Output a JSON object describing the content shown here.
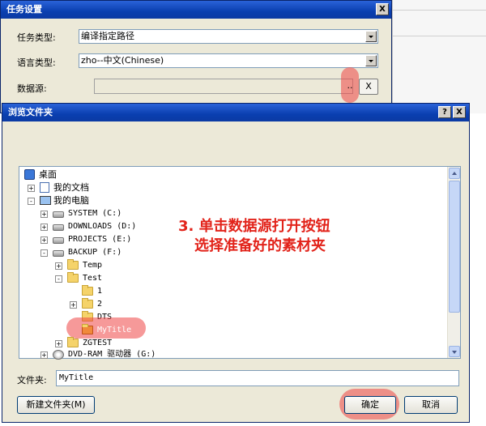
{
  "task_window": {
    "title": "任务设置",
    "close_glyph": "X",
    "task_type_label": "任务类型:",
    "task_type_value": "编译指定路径",
    "language_label": "语言类型:",
    "language_value": "zho--中文(Chinese)",
    "data_source_label": "数据源:",
    "browse_glyph": "..",
    "clear_label": "X"
  },
  "browse_dialog": {
    "title": "浏览文件夹",
    "help_glyph": "?",
    "close_glyph": "X",
    "tree": [
      {
        "label": "桌面",
        "expander": "",
        "icon": "desktop-icon"
      },
      {
        "label": "我的文档",
        "expander": "+",
        "icon": "my-documents-icon"
      },
      {
        "label": "我的电脑",
        "expander": "-",
        "icon": "my-computer-icon"
      },
      {
        "label": "SYSTEM (C:)",
        "expander": "+",
        "icon": "drive-icon"
      },
      {
        "label": "DOWNLOADS (D:)",
        "expander": "+",
        "icon": "drive-icon"
      },
      {
        "label": "PROJECTS (E:)",
        "expander": "+",
        "icon": "drive-icon"
      },
      {
        "label": "BACKUP (F:)",
        "expander": "-",
        "icon": "drive-icon"
      },
      {
        "label": "Temp",
        "expander": "+",
        "icon": "folder-icon"
      },
      {
        "label": "Test",
        "expander": "-",
        "icon": "folder-open-icon"
      },
      {
        "label": "1",
        "expander": "",
        "icon": "folder-icon"
      },
      {
        "label": "2",
        "expander": "+",
        "icon": "folder-icon"
      },
      {
        "label": "DTS",
        "expander": "",
        "icon": "folder-icon"
      },
      {
        "label": "MyTitle",
        "expander": "",
        "icon": "folder-icon"
      },
      {
        "label": "ZGTEST",
        "expander": "+",
        "icon": "folder-icon"
      },
      {
        "label": "DVD-RAM 驱动器 (G:)",
        "expander": "+",
        "icon": "dvd-drive-icon"
      }
    ],
    "annotation_line1": "3. 单击数据源打开按钮",
    "annotation_line2": "选择准备好的素材夹",
    "folder_label": "文件夹:",
    "folder_value": "MyTitle",
    "new_folder_button": "新建文件夹(M)",
    "ok_button": "确定",
    "cancel_button": "取消"
  },
  "colors": {
    "annotation": "#e2231a",
    "highlight": "#ee4646",
    "titlebar": "#0a3fb0"
  }
}
